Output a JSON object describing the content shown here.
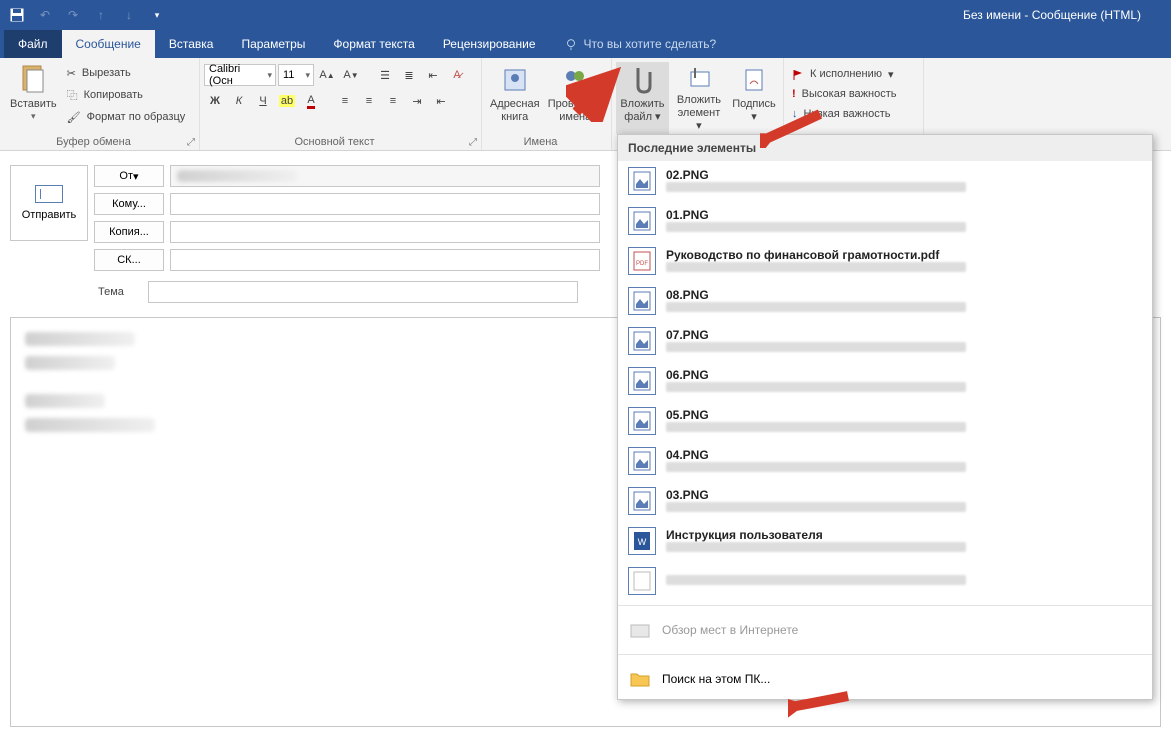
{
  "title": "Без имени - Сообщение (HTML)",
  "tabs": {
    "file": "Файл",
    "message": "Сообщение",
    "insert": "Вставка",
    "options": "Параметры",
    "format": "Формат текста",
    "review": "Рецензирование",
    "tellme": "Что вы хотите сделать?"
  },
  "ribbon": {
    "clipboard": {
      "paste": "Вставить",
      "cut": "Вырезать",
      "copy": "Копировать",
      "painter": "Формат по образцу",
      "label": "Буфер обмена"
    },
    "font": {
      "name": "Calibri (Осн",
      "size": "11",
      "label": "Основной текст"
    },
    "names": {
      "address": "Адресная книга",
      "check": "Проверить имена",
      "label": "Имена"
    },
    "include": {
      "attach_file": "Вложить файл",
      "attach_item": "Вложить элемент",
      "signature": "Подпись"
    },
    "tags": {
      "followup": "К исполнению",
      "high": "Высокая важность",
      "low": "Низкая важность"
    }
  },
  "compose": {
    "send": "Отправить",
    "from": "От",
    "to": "Кому...",
    "cc": "Копия...",
    "bcc": "СК...",
    "subject_label": "Тема"
  },
  "dropdown": {
    "header": "Последние элементы",
    "items": [
      {
        "title": "02.PNG",
        "type": "img"
      },
      {
        "title": "01.PNG",
        "type": "img"
      },
      {
        "title": "Руководство по финансовой грамотности.pdf",
        "type": "pdf"
      },
      {
        "title": "08.PNG",
        "type": "img"
      },
      {
        "title": "07.PNG",
        "type": "img"
      },
      {
        "title": "06.PNG",
        "type": "img"
      },
      {
        "title": "05.PNG",
        "type": "img"
      },
      {
        "title": "04.PNG",
        "type": "img"
      },
      {
        "title": "03.PNG",
        "type": "img"
      },
      {
        "title": "Инструкция пользователя",
        "type": "doc"
      },
      {
        "title": "",
        "type": "generic"
      }
    ],
    "browse_web": "Обзор мест в Интернете",
    "browse_pc": "Поиск на этом ПК..."
  }
}
